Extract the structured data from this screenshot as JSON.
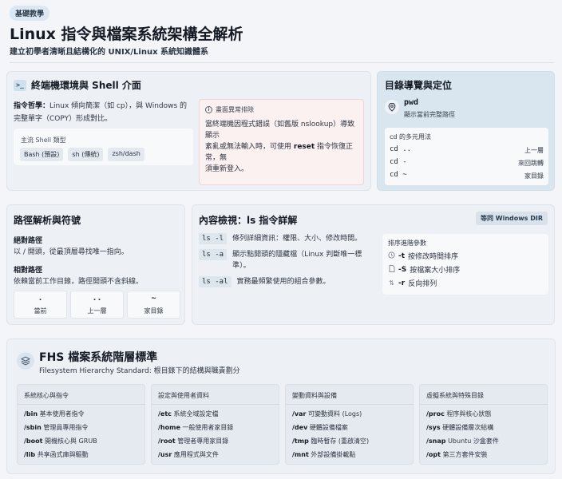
{
  "header": {
    "badge": "基礎教學",
    "title": "Linux 指令與檔案系統架構全解析",
    "subtitle": "建立初學者清晰且結構化的 UNIX/Linux 系統知識體系"
  },
  "terminal": {
    "icon_text": ">_",
    "title": "終端機環境與 Shell 介面",
    "philosophy_label": "指令哲學：",
    "philosophy_line1": "Linux 傾向簡潔（如 cp），與 Windows 的",
    "philosophy_line2": "完整單字（COPY）形成對比。",
    "shell_label": "主流 Shell 類型",
    "shells": [
      "Bash (預設)",
      "sh (傳統)",
      "zsh/dash"
    ],
    "alert_title": "畫面異常排除",
    "alert_line1": "當終端機因程式錯誤（如舊版 nslookup）導致顯示",
    "alert_line2_pre": "紊亂或無法輸入時，可使用 ",
    "alert_cmd": "reset",
    "alert_line2_post": " 指令恢復正常，無",
    "alert_line3": "須重新登入。"
  },
  "directory": {
    "title": "目錄導覽與定位",
    "pwd_cmd": "pwd",
    "pwd_desc": "顯示當前完整路徑",
    "cd_label": "cd 的多元用法",
    "cd_rows": [
      {
        "cmd": "cd ..",
        "desc": "上一層"
      },
      {
        "cmd": "cd -",
        "desc": "來回跳轉"
      },
      {
        "cmd": "cd ~",
        "desc": "家目錄"
      }
    ]
  },
  "path": {
    "title": "路徑解析與符號",
    "abs_label": "絕對路徑",
    "abs_desc": "以 / 開頭，從最頂層尋找唯一指向。",
    "rel_label": "相對路徑",
    "rel_desc": "依賴當前工作目錄，路徑開頭不含斜線。",
    "symbols": [
      {
        "sym": ".",
        "meaning": "當前"
      },
      {
        "sym": "..",
        "meaning": "上一層"
      },
      {
        "sym": "~",
        "meaning": "家目錄"
      }
    ]
  },
  "ls": {
    "title": "內容檢視：ls 指令詳解",
    "badge": "等同 Windows DIR",
    "rows": [
      {
        "flag": "ls -l",
        "desc1": "條列詳細資訊：權限、大小、修改時間。",
        "desc2": ""
      },
      {
        "flag": "ls -a",
        "desc1": "顯示點開頭的隱藏檔（Linux 判斷唯一標",
        "desc2": "準）。"
      },
      {
        "flag": "ls -al",
        "desc1": "實務最頻繁使用的組合參數。",
        "desc2": ""
      }
    ],
    "sort_label": "排序進階參數",
    "sorts": [
      {
        "icon": "clock-icon",
        "flag": "-t",
        "desc": "按修改時間排序"
      },
      {
        "icon": "file-icon",
        "flag": "-S",
        "desc": "按檔案大小排序"
      },
      {
        "icon": "swap-icon",
        "flag": "-r",
        "desc": "反向排列"
      }
    ]
  },
  "fhs": {
    "title": "FHS 檔案系統階層標準",
    "subtitle": "Filesystem Hierarchy Standard: 根目錄下的結構與職責劃分",
    "columns": [
      {
        "heading": "系統核心與指令",
        "items": [
          {
            "path": "/bin",
            "desc": "基本使用者指令"
          },
          {
            "path": "/sbin",
            "desc": "管理員專用指令"
          },
          {
            "path": "/boot",
            "desc": "開機核心與 GRUB"
          },
          {
            "path": "/lib",
            "desc": "共享函式庫與驅動"
          }
        ]
      },
      {
        "heading": "設定與使用者資料",
        "items": [
          {
            "path": "/etc",
            "desc": "系統全域設定檔"
          },
          {
            "path": "/home",
            "desc": "一般使用者家目錄"
          },
          {
            "path": "/root",
            "desc": "管理者專用家目錄"
          },
          {
            "path": "/usr",
            "desc": "應用程式與文件"
          }
        ]
      },
      {
        "heading": "變動資料與設備",
        "items": [
          {
            "path": "/var",
            "desc": "可變動資料 (Logs)"
          },
          {
            "path": "/dev",
            "desc": "硬體設備檔案"
          },
          {
            "path": "/tmp",
            "desc": "臨時暫存 (重啟清空)"
          },
          {
            "path": "/mnt",
            "desc": "外部設備掛載點"
          }
        ]
      },
      {
        "heading": "虛擬系統與特殊目錄",
        "items": [
          {
            "path": "/proc",
            "desc": "程序與核心狀態"
          },
          {
            "path": "/sys",
            "desc": "硬體設備層次結構"
          },
          {
            "path": "/snap",
            "desc": "Ubuntu 沙盒套件"
          },
          {
            "path": "/opt",
            "desc": "第三方套件安裝"
          }
        ]
      }
    ]
  },
  "colors": {
    "background": "#f3f5f8",
    "card": "#edf1f6",
    "nav_card": "#d9e6ef",
    "alert_bg": "#fbf1f1"
  }
}
